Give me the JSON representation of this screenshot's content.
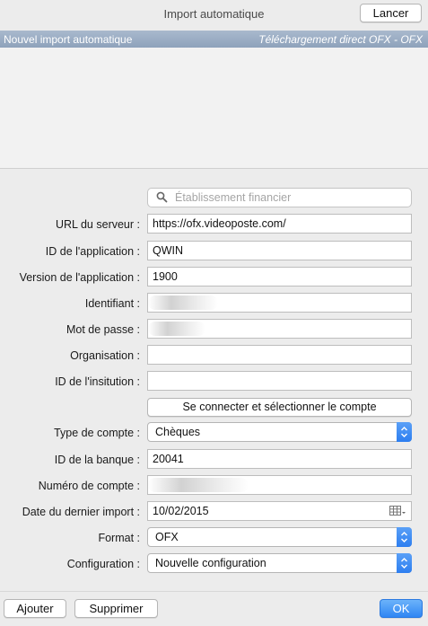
{
  "window": {
    "title": "Import automatique",
    "cancel_label": "Lancer"
  },
  "list": {
    "selected_name": "Nouvel import automatique",
    "selected_type": "Téléchargement direct OFX - OFX"
  },
  "search": {
    "placeholder": "Établissement financier"
  },
  "form": {
    "server_url": {
      "label": "URL du serveur :",
      "value": "https://ofx.videoposte.com/"
    },
    "app_id": {
      "label": "ID de l'application :",
      "value": "QWIN"
    },
    "app_version": {
      "label": "Version de l'application :",
      "value": "1900"
    },
    "identifier": {
      "label": "Identifiant :",
      "value": ""
    },
    "password": {
      "label": "Mot de passe :",
      "value": ""
    },
    "organisation": {
      "label": "Organisation :",
      "value": ""
    },
    "institution_id": {
      "label": "ID de l'insitution :",
      "value": ""
    },
    "connect_label": "Se connecter et sélectionner le compte",
    "account_type": {
      "label": "Type de compte :",
      "value": "Chèques"
    },
    "bank_id": {
      "label": "ID de la banque :",
      "value": "20041"
    },
    "account_number": {
      "label": "Numéro de compte :",
      "value": ""
    },
    "last_import": {
      "label": "Date du dernier import :",
      "value": "10/02/2015"
    },
    "format": {
      "label": "Format :",
      "value": "OFX"
    },
    "configuration": {
      "label": "Configuration :",
      "value": "Nouvelle configuration"
    }
  },
  "footer": {
    "add_label": "Ajouter",
    "delete_label": "Supprimer",
    "ok_label": "OK"
  },
  "icons": {
    "search": "search-icon",
    "calendar": "calendar-icon",
    "select_arrows": "chevron-up-down-icon"
  },
  "colors": {
    "accent": "#2f86f3",
    "list_header": "#9aacc3"
  }
}
